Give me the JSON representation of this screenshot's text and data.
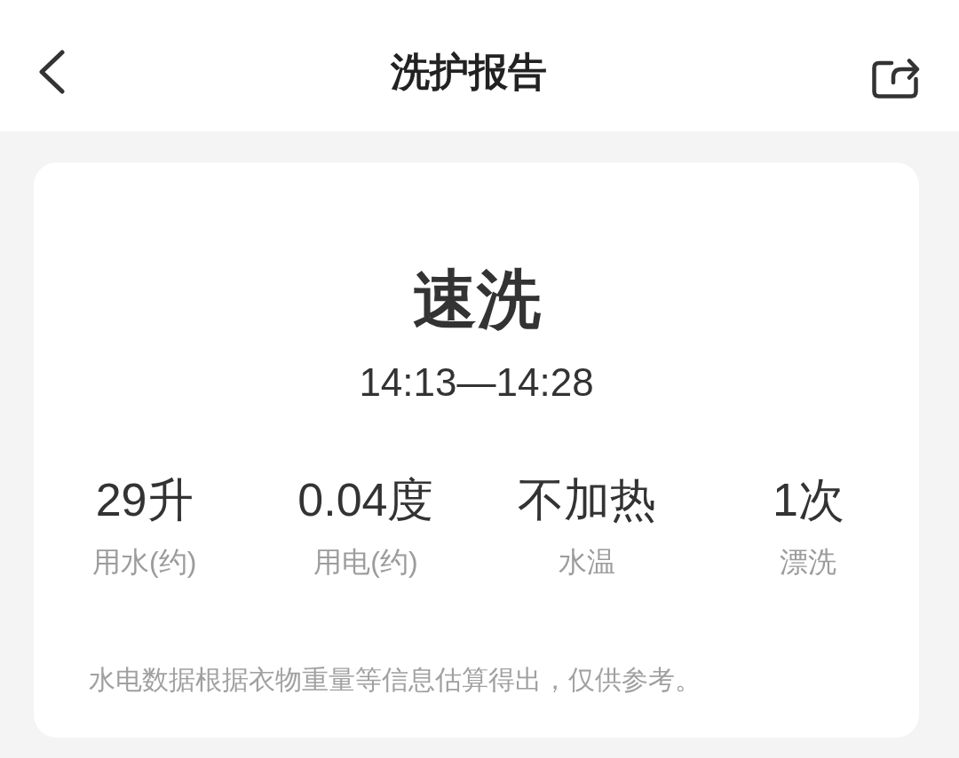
{
  "header": {
    "title": "洗护报告"
  },
  "report": {
    "program": "速洗",
    "time_range": "14:13—14:28",
    "stats": [
      {
        "value": "29升",
        "label": "用水(约)"
      },
      {
        "value": "0.04度",
        "label": "用电(约)"
      },
      {
        "value": "不加热",
        "label": "水温"
      },
      {
        "value": "1次",
        "label": "漂洗"
      }
    ],
    "note": "水电数据根据衣物重量等信息估算得出，仅供参考。"
  }
}
